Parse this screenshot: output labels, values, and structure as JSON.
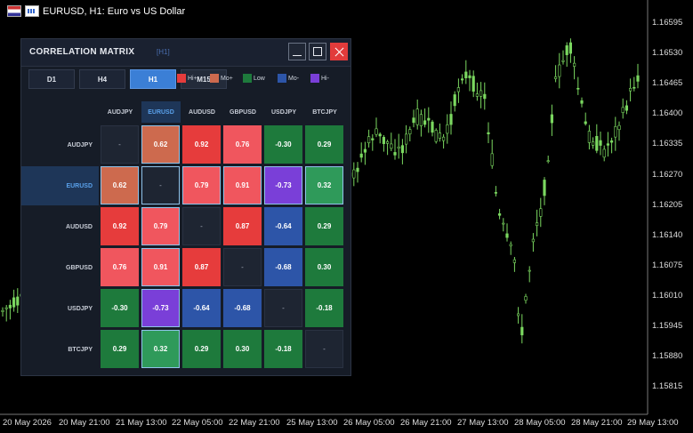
{
  "chart": {
    "symbol_line": "EURUSD, H1:  Euro vs US Dollar",
    "price_axis": [
      "1.16595",
      "1.16530",
      "1.16465",
      "1.16400",
      "1.16335",
      "1.16270",
      "1.16205",
      "1.16140",
      "1.16075",
      "1.16010",
      "1.15945",
      "1.15880",
      "1.15815"
    ],
    "time_axis": [
      "20 May 2026",
      "20 May 21:00",
      "21 May 13:00",
      "22 May 05:00",
      "22 May 21:00",
      "25 May 13:00",
      "26 May 05:00",
      "26 May 21:00",
      "27 May 13:00",
      "28 May 05:00",
      "28 May 21:00",
      "29 May 13:00"
    ],
    "candle_color": "#7bd860",
    "background": "#000000"
  },
  "panel": {
    "title": "CORRELATION MATRIX",
    "timeframe_tag": "[H1]",
    "timeframes": [
      {
        "label": "D1",
        "active": false
      },
      {
        "label": "H4",
        "active": false
      },
      {
        "label": "H1",
        "active": true
      },
      {
        "label": "M15",
        "active": false
      }
    ],
    "legend": [
      {
        "label": "Hi+",
        "color": "#e63c3c"
      },
      {
        "label": "Mo+",
        "color": "#cd6a4e"
      },
      {
        "label": "Low",
        "color": "#1e7a3c"
      },
      {
        "label": "Mo-",
        "color": "#2d55a8"
      },
      {
        "label": "Hi-",
        "color": "#7a3fd8"
      }
    ],
    "symbols": [
      "AUDJPY",
      "EURUSD",
      "AUDUSD",
      "GBPUSD",
      "USDJPY",
      "BTCJPY"
    ],
    "highlighted_symbol": "EURUSD",
    "matrix": [
      [
        "-",
        "0.62",
        "0.92",
        "0.76",
        "-0.30",
        "0.29"
      ],
      [
        "0.62",
        "-",
        "0.79",
        "0.91",
        "-0.73",
        "0.32"
      ],
      [
        "0.92",
        "0.79",
        "-",
        "0.87",
        "-0.64",
        "0.29"
      ],
      [
        "0.76",
        "0.91",
        "0.87",
        "-",
        "-0.68",
        "0.30"
      ],
      [
        "-0.30",
        "-0.73",
        "-0.64",
        "-0.68",
        "-",
        "-0.18"
      ],
      [
        "0.29",
        "0.32",
        "0.29",
        "0.30",
        "-0.18",
        "-"
      ]
    ],
    "cell_colors": {
      "hi_pos": "#e63c3c",
      "hi_pos_light": "#f0565e",
      "mo_pos": "#cd6a4e",
      "low": "#1e7a3c",
      "low_light": "#2f9a5a",
      "mo_neg": "#2d55a8",
      "hi_neg": "#7a3fd8"
    }
  }
}
